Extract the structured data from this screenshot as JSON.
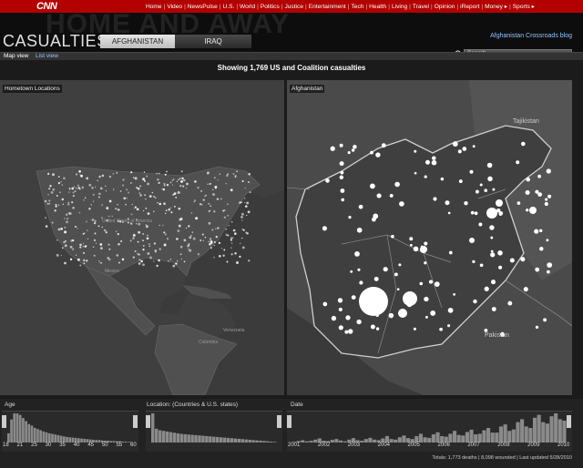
{
  "brand": {
    "logo": "CNN"
  },
  "nav": [
    "Home",
    "Video",
    "NewsPulse",
    "U.S.",
    "World",
    "Politics",
    "Justice",
    "Entertainment",
    "Tech",
    "Health",
    "Living",
    "Travel",
    "Opinion",
    "iReport",
    "Money ▸",
    "Sports ▸"
  ],
  "header": {
    "background_title": "HOME AND AWAY",
    "title": "CASUALTIES:",
    "tabs": [
      {
        "label": "AFGHANISTAN",
        "active": true
      },
      {
        "label": "IRAQ",
        "active": false
      }
    ],
    "blog_link": "Afghanistan Crossroads blog",
    "search_placeholder": "Search"
  },
  "views": {
    "map": "Map view",
    "list": "List view"
  },
  "summary": "Showing 1,769 US and Coalition casualties",
  "panels": {
    "left": {
      "label": "Hometown Locations",
      "places": {
        "us": "United States of America",
        "mexico": "Mexico",
        "colombia": "Colombia",
        "venezuela": "Venezuela"
      }
    },
    "right": {
      "label": "Afghanistan",
      "places": {
        "tajikistan": "Tajikistan",
        "pakistan": "Pakistan"
      }
    }
  },
  "filters": {
    "age": {
      "label": "Age",
      "ticks": [
        "18",
        "21",
        "25",
        "30",
        "35",
        "40",
        "45",
        "50",
        "55",
        "60"
      ]
    },
    "location": {
      "label": "Location: (Countries & U.S. states)"
    },
    "date": {
      "label": "Date",
      "ticks": [
        "2001",
        "2002",
        "2003",
        "2004",
        "2005",
        "2006",
        "2007",
        "2008",
        "2009",
        "2010"
      ]
    }
  },
  "footer": "Totals: 1,773 deaths | 8,098 wounded | Last updated 5/28/2010",
  "colors": {
    "nav_red": "#b30000",
    "link_blue": "#8fc6ff",
    "accent_white": "#ffffff"
  },
  "chart_data": [
    {
      "type": "bar",
      "title": "Age",
      "categories": [
        "18",
        "19",
        "20",
        "21",
        "22",
        "23",
        "24",
        "25",
        "26",
        "27",
        "28",
        "29",
        "30",
        "31",
        "32",
        "33",
        "34",
        "35",
        "36",
        "37",
        "38",
        "39",
        "40",
        "41",
        "42",
        "43",
        "44",
        "45",
        "46",
        "47",
        "48",
        "49",
        "50",
        "51",
        "52",
        "53",
        "54",
        "55",
        "56",
        "57",
        "58",
        "59",
        "60"
      ],
      "values": [
        30,
        75,
        95,
        95,
        90,
        80,
        70,
        60,
        55,
        48,
        44,
        40,
        36,
        33,
        30,
        28,
        26,
        24,
        22,
        20,
        18,
        17,
        16,
        15,
        14,
        13,
        12,
        11,
        10,
        9,
        8,
        8,
        7,
        6,
        6,
        5,
        5,
        4,
        4,
        3,
        3,
        2,
        2
      ]
    },
    {
      "type": "bar",
      "title": "Location: (Countries & U.S. states)",
      "values": [
        95,
        45,
        40,
        38,
        36,
        34,
        32,
        30,
        28,
        27,
        26,
        25,
        24,
        23,
        22,
        21,
        20,
        19,
        18,
        17,
        16,
        15,
        14,
        13,
        12,
        11,
        10,
        9,
        8,
        7,
        6,
        5,
        4,
        3,
        2
      ]
    },
    {
      "type": "bar",
      "title": "Date",
      "categories": [
        "2001",
        "2002",
        "2003",
        "2004",
        "2005",
        "2006",
        "2007",
        "2008",
        "2009",
        "2010"
      ],
      "values": [
        2,
        5,
        8,
        4,
        6,
        10,
        14,
        6,
        5,
        9,
        12,
        7,
        4,
        10,
        15,
        8,
        6,
        12,
        16,
        10,
        8,
        14,
        22,
        12,
        10,
        18,
        24,
        15,
        12,
        22,
        30,
        18,
        16,
        28,
        35,
        22,
        20,
        30,
        40,
        26,
        24,
        36,
        44,
        28,
        30,
        42,
        50,
        34,
        34,
        55,
        62,
        40,
        45,
        70,
        80,
        55,
        50,
        85,
        95,
        70,
        65,
        90,
        100,
        80,
        75
      ]
    }
  ]
}
